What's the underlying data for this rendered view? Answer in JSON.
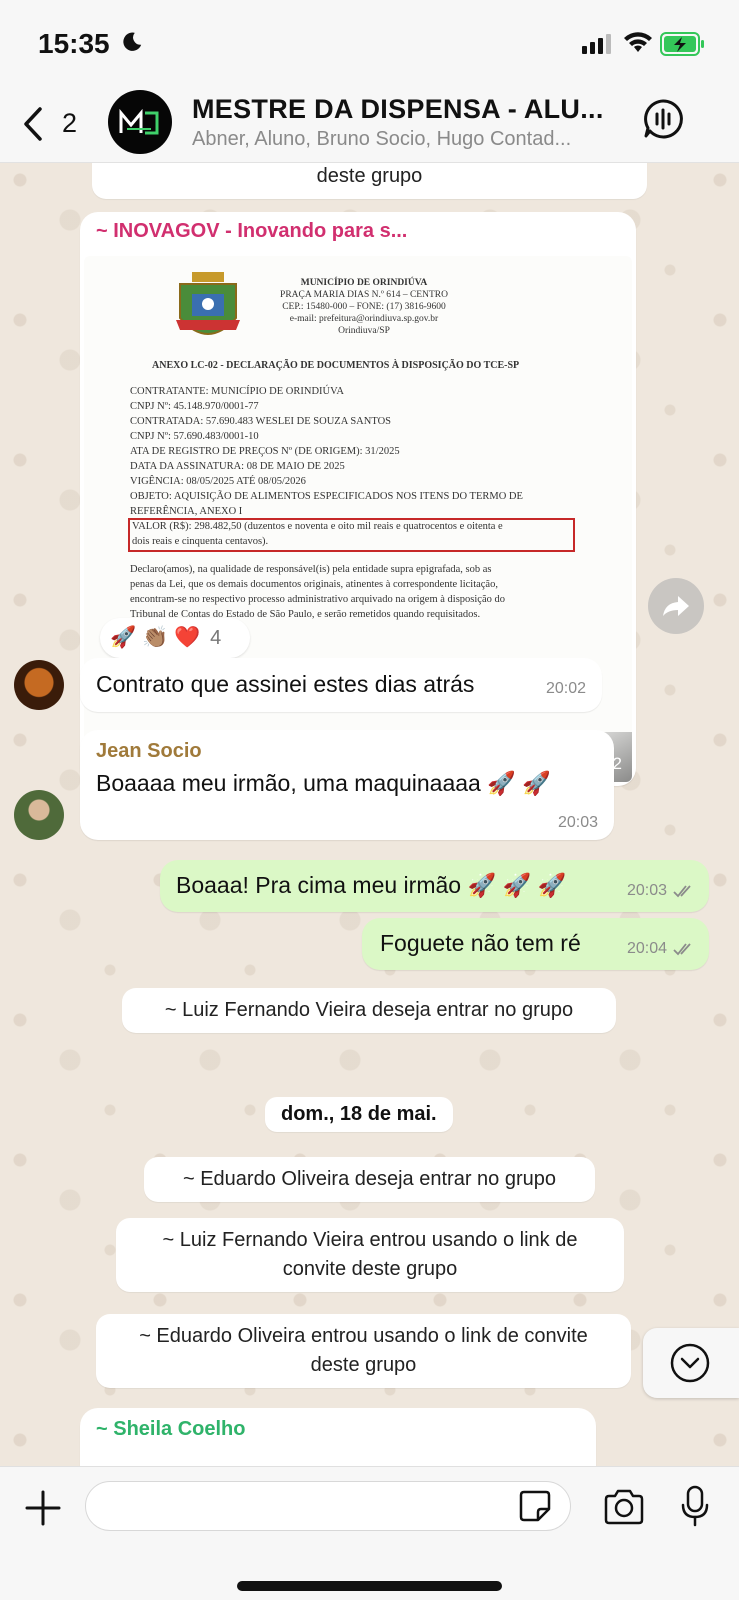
{
  "status_bar": {
    "time": "15:35"
  },
  "header": {
    "back_count": "2",
    "avatar_text": "M",
    "title": "MESTRE DA DISPENSA - ALU...",
    "subtitle": "Abner, Aluno, Bruno Socio, Hugo Contad..."
  },
  "messages": {
    "top_system_tail": "deste grupo",
    "doc_message": {
      "sender": "~ INOVAGOV - Inovando para s...",
      "time": "20:02",
      "document": {
        "municipio": "MUNICÍPIO DE ORINDIÚVA",
        "endereco": "PRAÇA MARIA DIAS N.º 614 – CENTRO",
        "cep": "CEP.: 15480-000 – FONE: (17) 3816-9600",
        "email": "e-mail: prefeitura@orindiuva.sp.gov.br",
        "cidade": "Orindiuva/SP",
        "titulo": "ANEXO LC-02 - DECLARAÇÃO DE DOCUMENTOS À DISPOSIÇÃO DO TCE-SP",
        "lines": [
          "CONTRATANTE: MUNICÍPIO DE ORINDIÚVA",
          "CNPJ Nº: 45.148.970/0001-77",
          "CONTRATADA: 57.690.483 WESLEI DE SOUZA SANTOS",
          "CNPJ Nº: 57.690.483/0001-10",
          "ATA DE REGISTRO DE PREÇOS Nº (DE ORIGEM): 31/2025",
          "DATA DA ASSINATURA: 08 DE MAIO DE 2025",
          "VIGÊNCIA: 08/05/2025 ATÉ 08/05/2026",
          "OBJETO: AQUISIÇÃO DE ALIMENTOS ESPECIFICADOS NOS ITENS DO TERMO DE",
          "REFERÊNCIA, ANEXO I"
        ],
        "valor_1": "VALOR (R$): 298.482,50 (duzentos e noventa e oito mil reais e quatrocentos e oitenta e",
        "valor_2": "dois reais e cinquenta centavos).",
        "decl_lines": [
          "Declaro(amos), na qualidade de responsável(is) pela entidade supra epigrafada, sob as",
          "penas da Lei, que os demais documentos originais, atinentes à correspondente licitação,",
          "encontram-se no respectivo processo administrativo arquivado na origem à disposição do",
          "Tribunal de Contas do Estado de São Paulo, e serão remetidos quando requisitados."
        ]
      },
      "reactions": {
        "emojis": "🚀 👏🏽 ❤️",
        "count": "4"
      }
    },
    "contract_msg": {
      "text": "Contrato que assinei estes dias atrás",
      "time": "20:02"
    },
    "jean_msg": {
      "sender": "Jean Socio",
      "text": "Boaaaa meu irmão, uma maquinaaaa 🚀 🚀",
      "time": "20:03"
    },
    "out_1": {
      "text": "Boaaa! Pra cima meu irmão 🚀 🚀 🚀",
      "time": "20:03"
    },
    "out_2": {
      "text": "Foguete não tem ré",
      "time": "20:04"
    },
    "sys_luiz_request": "~ Luiz Fernando Vieira deseja entrar no grupo",
    "date_divider": "dom., 18 de mai.",
    "sys_eduardo_request": "~ Eduardo Oliveira deseja entrar no grupo",
    "sys_luiz_joined_1": "~ Luiz Fernando Vieira entrou usando o link de",
    "sys_luiz_joined_2": "convite deste grupo",
    "sys_eduardo_joined_1": "~ Eduardo Oliveira entrou usando o link de convite",
    "sys_eduardo_joined_2": "deste grupo",
    "sheila_sender": "~ Sheila Coelho"
  },
  "input": {
    "placeholder": ""
  },
  "colors": {
    "inovagov_name": "#d12f6f",
    "jean_name": "#a07a3a",
    "sheila_name": "#2fb36a",
    "outgoing_bubble": "#dbf8c6",
    "read_ticks": "#8b8b8b"
  },
  "icons": [
    "moon-icon",
    "signal-icon",
    "wifi-icon",
    "battery-icon",
    "back-icon",
    "voice-chat-icon",
    "forward-icon",
    "chevron-down-icon",
    "plus-icon",
    "sticker-icon",
    "camera-icon",
    "mic-icon"
  ]
}
